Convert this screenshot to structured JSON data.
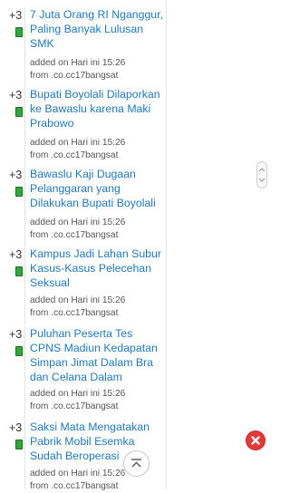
{
  "feed": {
    "items": [
      {
        "count": "+3",
        "title": "7 Juta Orang RI Nganggur, Paling Banyak Lulusan SMK",
        "added": "added on Hari ini 15:26",
        "from": "from .co.cc17bangsat"
      },
      {
        "count": "+3",
        "title": "Bupati Boyolali Dilaporkan ke Bawaslu karena Maki Prabowo",
        "added": "added on Hari ini 15:26",
        "from": "from .co.cc17bangsat"
      },
      {
        "count": "+3",
        "title": "Bawaslu Kaji Dugaan Pelanggaran yang Dilakukan Bupati Boyolali",
        "added": "added on Hari ini 15:26",
        "from": "from .co.cc17bangsat"
      },
      {
        "count": "+3",
        "title": "Kampus Jadi Lahan Subur Kasus-Kasus Pelecehan Seksual",
        "added": "added on Hari ini 15:26",
        "from": "from .co.cc17bangsat"
      },
      {
        "count": "+3",
        "title": "Puluhan Peserta Tes CPNS Madiun Kedapatan Simpan Jimat Dalam Bra dan Celana Dalam",
        "added": "added on Hari ini 15:26",
        "from": "from .co.cc17bangsat"
      },
      {
        "count": "+3",
        "title": "Saksi Mata Mengatakan Pabrik Mobil Esemka Sudah Beroperasi",
        "added": "added on Hari ini 15:26",
        "from": "from .co.cc17bangsat"
      }
    ]
  },
  "colors": {
    "link": "#1f78c1",
    "vote_bar": "#2fa83a",
    "close": "#e53935"
  },
  "icons": {
    "scroll": "scroll-handle-icon",
    "close": "close-icon",
    "back_to_top": "back-to-top-icon"
  }
}
